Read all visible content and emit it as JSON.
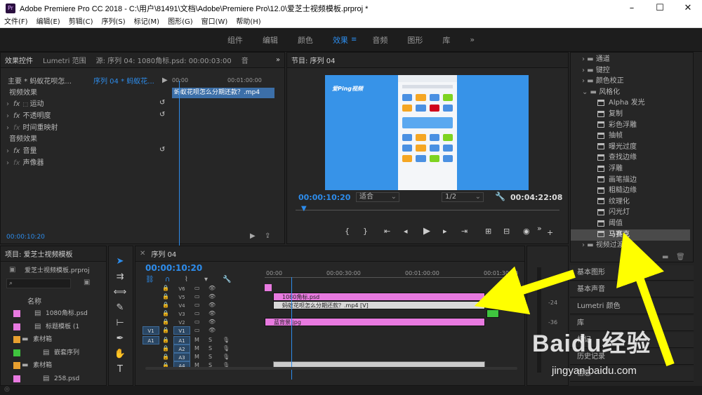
{
  "titlebar": {
    "title": "Adobe Premiere Pro CC 2018 - C:\\用户\\81491\\文档\\Adobe\\Premiere Pro\\12.0\\爱芝士视频模板.prproj *",
    "app_badge": "Pr"
  },
  "menu": [
    "文件(F)",
    "编辑(E)",
    "剪辑(C)",
    "序列(S)",
    "标记(M)",
    "图形(G)",
    "窗口(W)",
    "帮助(H)"
  ],
  "workspaces": [
    "组件",
    "编辑",
    "颜色",
    "效果",
    "音频",
    "图形",
    "库"
  ],
  "effect_controls": {
    "tabs": [
      "效果控件",
      "Lumetri 范围",
      "源: 序列 04: 1080角标.psd: 00:00:03:00",
      "音"
    ],
    "master": "主要 * 蚂蚁花呗怎...",
    "sequence": "序列 04 * 蚂蚁花...",
    "time0": "00:00",
    "time1": "00:01:00:00",
    "clip_label": "蚂蚁花呗怎么分期还款？.mp4",
    "video_section": "视频效果",
    "motion": "运动",
    "opacity": "不透明度",
    "remap": "时间重映射",
    "audio_section": "音频效果",
    "volume": "音量",
    "panner": "声像器",
    "timecode": "00:00:10:20"
  },
  "program": {
    "title": "节目: 序列 04",
    "timecode": "00:00:10:20",
    "fit": "适合",
    "quality": "1/2",
    "duration": "00:04:22:08",
    "watermark": "爱Ping视频"
  },
  "effects": {
    "items": [
      {
        "label": "通道",
        "type": "folder"
      },
      {
        "label": "键控",
        "type": "folder"
      },
      {
        "label": "颜色校正",
        "type": "folder"
      },
      {
        "label": "风格化",
        "type": "folder-open"
      },
      {
        "label": "Alpha 发光",
        "type": "fx"
      },
      {
        "label": "复制",
        "type": "fx"
      },
      {
        "label": "彩色浮雕",
        "type": "fx"
      },
      {
        "label": "抽帧",
        "type": "fx"
      },
      {
        "label": "曝光过度",
        "type": "fx"
      },
      {
        "label": "查找边缘",
        "type": "fx"
      },
      {
        "label": "浮雕",
        "type": "fx"
      },
      {
        "label": "画笔描边",
        "type": "fx"
      },
      {
        "label": "粗糙边缘",
        "type": "fx"
      },
      {
        "label": "纹理化",
        "type": "fx"
      },
      {
        "label": "闪光灯",
        "type": "fx"
      },
      {
        "label": "阈值",
        "type": "fx"
      },
      {
        "label": "马赛克",
        "type": "fx",
        "selected": true
      },
      {
        "label": "视频过渡",
        "type": "folder"
      }
    ],
    "side_panels": [
      "基本图形",
      "基本声音",
      "Lumetri 颜色",
      "库",
      "标记",
      "历史记录",
      "信息"
    ]
  },
  "project": {
    "title": "项目: 爱芝士视频模板",
    "file": "爱芝士视频模板.prproj",
    "name_col": "名称",
    "items": [
      {
        "label": "1080角标.psd",
        "color": "#e87ae0"
      },
      {
        "label": "标题模板 (1",
        "color": "#e87ae0"
      },
      {
        "label": "素材箱",
        "color": "#e8a030"
      },
      {
        "label": "嵌套序列",
        "color": "#3fc43f"
      },
      {
        "label": "素材箱",
        "color": "#e8a030"
      },
      {
        "label": "258.psd",
        "color": "#e87ae0"
      }
    ]
  },
  "timeline": {
    "tab": "序列 04",
    "timecode": "00:00:10:20",
    "ruler": [
      "00:00",
      "00:00:30:00",
      "00:01:00:00",
      "00:01:30:00"
    ],
    "video_tracks": [
      "V6",
      "V5",
      "V4",
      "V3",
      "V2",
      "V1"
    ],
    "audio_tracks": [
      "A1",
      "A2",
      "A3",
      "A4"
    ],
    "src_v": "V1",
    "src_a": "A1",
    "mute": "M",
    "solo": "S",
    "clips": {
      "psd": "1080角标.psd",
      "mp4": "蚂蚁花呗怎么分期还款？.mp4 [V]",
      "jpg": "蓝背景.jpg"
    },
    "meter_ticks": [
      "-24",
      "-36"
    ]
  },
  "watermark": {
    "brand": "Baidu经验",
    "url": "jingyan.baidu.com"
  }
}
